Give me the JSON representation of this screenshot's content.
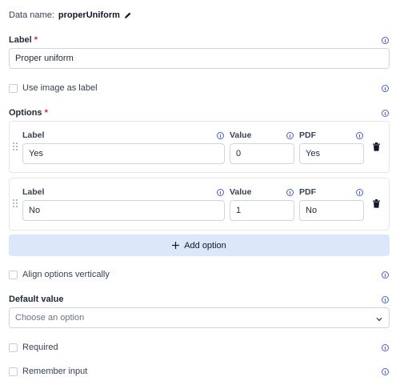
{
  "data_name": {
    "label": "Data name:",
    "value": "properUniform"
  },
  "label_field": {
    "label": "Label",
    "required_mark": "*",
    "value": "Proper uniform"
  },
  "use_image": {
    "label": "Use image as label"
  },
  "options": {
    "label": "Options",
    "required_mark": "*",
    "columns": {
      "label": "Label",
      "value": "Value",
      "pdf": "PDF"
    },
    "rows": [
      {
        "label": "Yes",
        "value": "0",
        "pdf": "Yes"
      },
      {
        "label": "No",
        "value": "1",
        "pdf": "No"
      }
    ],
    "add_label": "Add option"
  },
  "align_vertical": {
    "label": "Align options vertically"
  },
  "default_value": {
    "label": "Default value",
    "placeholder": "Choose an option"
  },
  "required": {
    "label": "Required"
  },
  "remember": {
    "label": "Remember input"
  },
  "colors": {
    "accent": "#4b5ccf",
    "add_bg": "#dbe7fb",
    "required": "#dc2626"
  }
}
